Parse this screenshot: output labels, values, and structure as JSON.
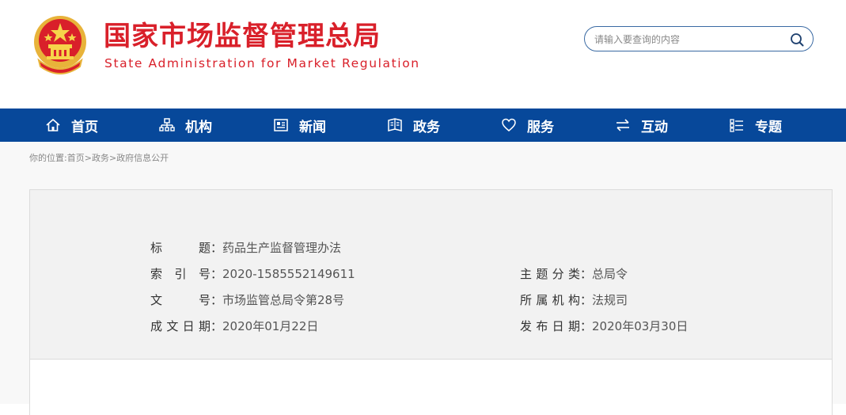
{
  "header": {
    "title_cn": "国家市场监督管理总局",
    "title_en": "State Administration for Market Regulation",
    "search_placeholder": "请输入要查询的内容",
    "brand_color": "#d9202a"
  },
  "nav": {
    "background": "#07489a",
    "items": [
      {
        "label": "首页",
        "icon": "home-icon"
      },
      {
        "label": "机构",
        "icon": "org-chart-icon"
      },
      {
        "label": "新闻",
        "icon": "news-icon"
      },
      {
        "label": "政务",
        "icon": "government-icon"
      },
      {
        "label": "服务",
        "icon": "heart-icon"
      },
      {
        "label": "互动",
        "icon": "exchange-icon"
      },
      {
        "label": "专题",
        "icon": "list-icon"
      }
    ]
  },
  "breadcrumb": {
    "prefix": "你的位置:",
    "items": [
      "首页",
      "政务",
      "政府信息公开"
    ],
    "separator": ">"
  },
  "doc": {
    "title_label": "标　　题",
    "title_value": "药品生产监督管理办法",
    "index_label": "索 引 号",
    "index_value": "2020-1585552149611",
    "category_label": "主题分类",
    "category_value": "总局令",
    "number_label": "文　　号",
    "number_value": "市场监管总局令第28号",
    "org_label": "所属机构",
    "org_value": "法规司",
    "created_label": "成文日期",
    "created_value": "2020年01月22日",
    "published_label": "发布日期",
    "published_value": "2020年03月30日",
    "colon": "："
  }
}
